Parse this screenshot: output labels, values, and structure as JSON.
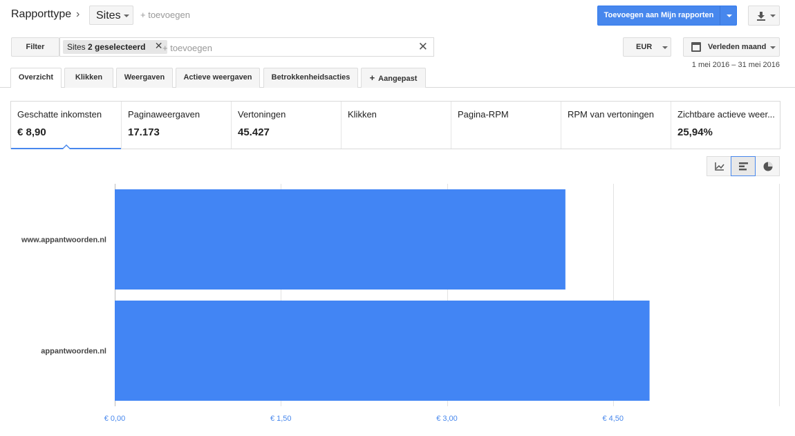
{
  "header": {
    "title": "Rapporttype",
    "dimension": "Sites",
    "add_label": "+ toevoegen",
    "primary_button": "Toevoegen aan Mijn rapporten"
  },
  "filter": {
    "button": "Filter",
    "chip_prefix": "Sites",
    "chip_value": "2 geselecteerd",
    "add_label": "+ toevoegen",
    "currency": "EUR",
    "date_preset": "Verleden maand",
    "date_range": "1 mei 2016 – 31 mei 2016"
  },
  "tabs": [
    "Overzicht",
    "Klikken",
    "Weergaven",
    "Actieve weergaven",
    "Betrokkenheidsacties",
    "Aangepast"
  ],
  "metrics": [
    {
      "name": "Geschatte inkomsten",
      "value": "€ 8,90"
    },
    {
      "name": "Paginaweergaven",
      "value": "17.173"
    },
    {
      "name": "Vertoningen",
      "value": "45.427"
    },
    {
      "name": "Klikken",
      "value": ""
    },
    {
      "name": "Pagina-RPM",
      "value": ""
    },
    {
      "name": "RPM van vertoningen",
      "value": ""
    },
    {
      "name": "Zichtbare actieve weer...",
      "value": "25,94%"
    }
  ],
  "colors": {
    "accent": "#4787ed",
    "bar": "#4285f4"
  },
  "chart_data": {
    "type": "bar",
    "orientation": "horizontal",
    "categories": [
      "www.appantwoorden.nl",
      "appantwoorden.nl"
    ],
    "values": [
      4.07,
      4.83
    ],
    "xlim": [
      0,
      6
    ],
    "ticks": [
      0,
      1.5,
      3.0,
      4.5
    ],
    "tick_labels": [
      "€ 0,00",
      "€ 1,50",
      "€ 3,00",
      "€ 4,50"
    ],
    "grid": true
  }
}
